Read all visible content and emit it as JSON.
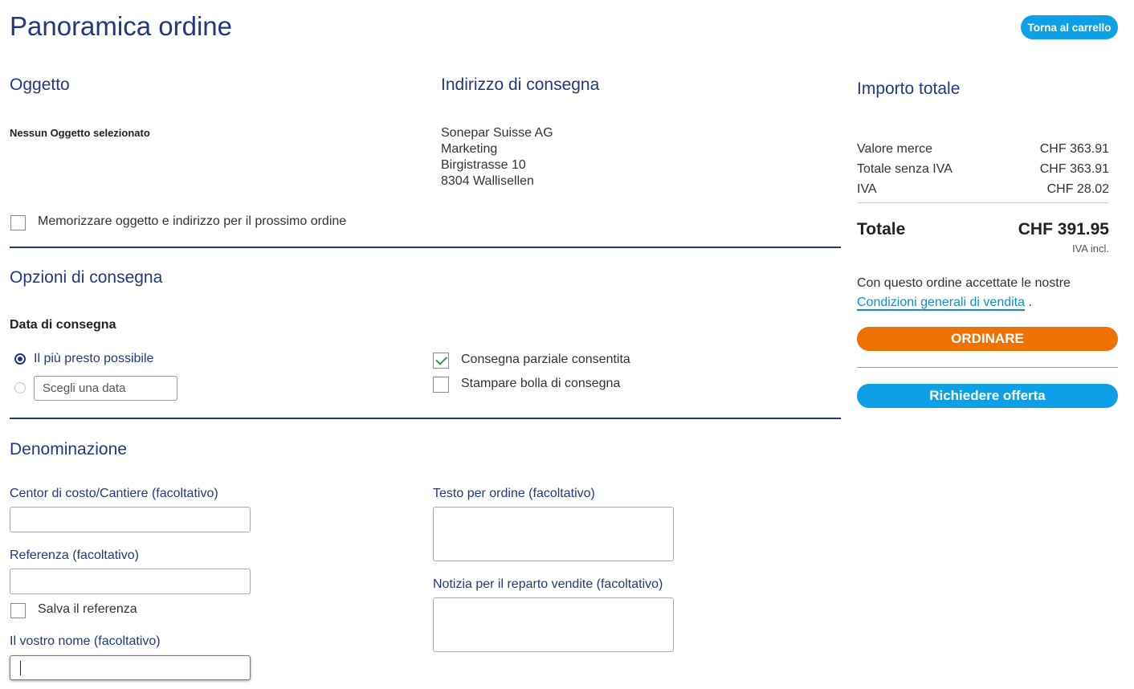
{
  "header": {
    "title": "Panoramica ordine",
    "back_button": "Torna al carrello"
  },
  "object_section": {
    "title": "Oggetto",
    "value": "Nessun Oggetto selezionato"
  },
  "delivery_address": {
    "title": "Indirizzo di consegna",
    "lines": [
      "Sonepar Suisse AG",
      "Marketing",
      "Birgistrasse 10",
      "8304 Wallisellen"
    ]
  },
  "remember_checkbox": {
    "label": "Memorizzare oggetto e indirizzo per il prossimo ordine",
    "checked": false
  },
  "delivery_options": {
    "title": "Opzioni di consegna",
    "date_title": "Data di consegna",
    "asap_label": "Il più presto possibile",
    "choose_date_placeholder": "Scegli una data",
    "selected": "asap",
    "partial_delivery": {
      "label": "Consegna parziale consentita",
      "checked": true
    },
    "print_note": {
      "label": "Stampare bolla di consegna",
      "checked": false
    }
  },
  "denomination": {
    "title": "Denominazione",
    "cost_center_label": "Centor di costo/Cantiere (facoltativo)",
    "cost_center_value": "",
    "reference_label": "Referenza (facoltativo)",
    "reference_value": "",
    "save_reference_label": "Salva il referenza",
    "save_reference_checked": false,
    "name_label": "Il vostro nome (facoltativo)",
    "name_value": "",
    "order_text_label": "Testo per ordine (facoltativo)",
    "sales_note_label": "Notizia per il reparto vendite (facoltativo)"
  },
  "summary": {
    "title": "Importo totale",
    "rows": [
      {
        "label": "Valore merce",
        "value": "CHF 363.91"
      },
      {
        "label": "Totale senza IVA",
        "value": "CHF 363.91"
      },
      {
        "label": "IVA",
        "value": "CHF 28.02"
      }
    ],
    "total_label": "Totale",
    "total_value": "CHF 391.95",
    "vat_note": "IVA incl.",
    "terms_text": "Con questo ordine accettate le nostre",
    "terms_link": "Condizioni generali di vendita",
    "terms_period": ".",
    "order_button": "ORDINARE",
    "offer_button": "Richiedere offerta"
  },
  "colors": {
    "navy": "#243881",
    "accent_blue": "#0ea0e6",
    "order_orange": "#ee7203",
    "check_green": "#2a9d3a"
  }
}
